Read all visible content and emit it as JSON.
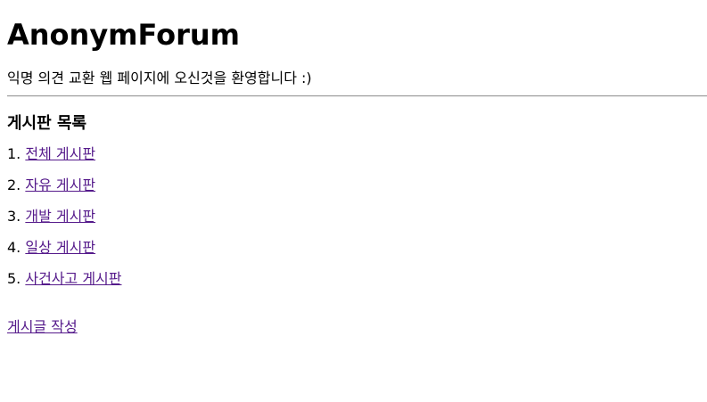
{
  "site": {
    "title": "AnonymForum",
    "welcome": "익명 의견 교환 웹 페이지에 오신것을 환영합니다 :)"
  },
  "boards": {
    "heading": "게시판 목록",
    "items": [
      {
        "number": "1.",
        "label": "전체 게시판"
      },
      {
        "number": "2.",
        "label": "자유 게시판"
      },
      {
        "number": "3.",
        "label": "개발 게시판"
      },
      {
        "number": "4.",
        "label": "일상 게시판"
      },
      {
        "number": "5.",
        "label": "사건사고 게시판"
      }
    ]
  },
  "actions": {
    "write_post": "게시글 작성"
  },
  "colors": {
    "link_visited": "#551a8b",
    "text": "#000000",
    "divider": "#9a9a9a"
  }
}
